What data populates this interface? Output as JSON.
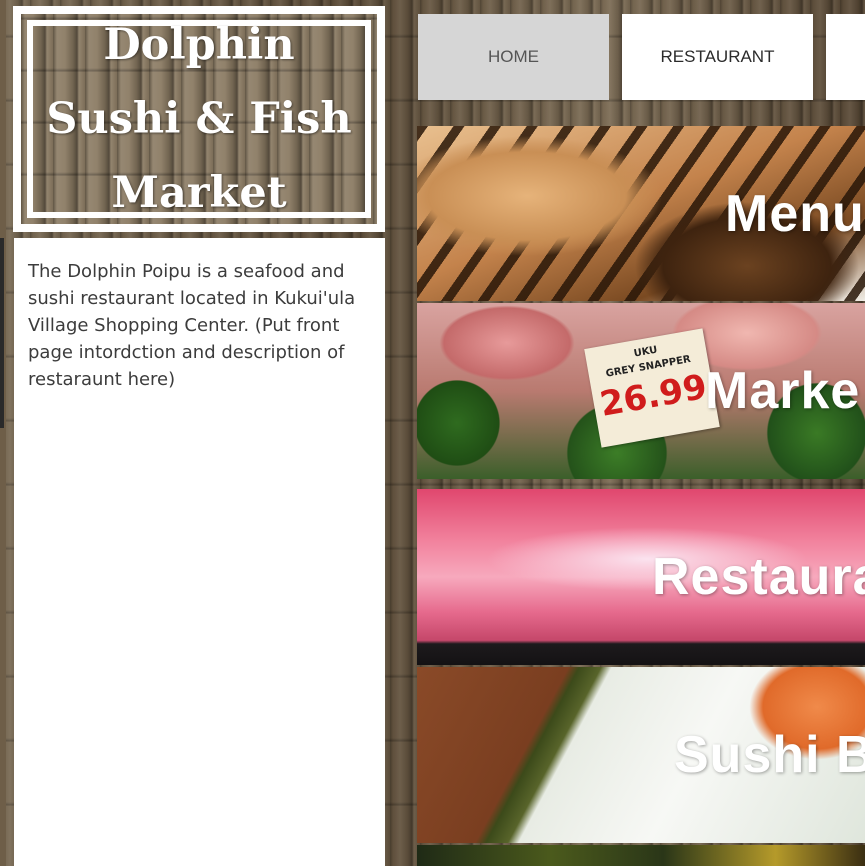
{
  "site": {
    "title": "Dolphin\nSushi & Fish\nMarket"
  },
  "intro": {
    "text": "The Dolphin Poipu is a seafood and sushi restaurant located in Kukui'ula Village Shopping Center. (Put front page intordction and description of restaraunt here)"
  },
  "nav": {
    "home_label": "HOME",
    "restaurant_label": "RESTAURANT",
    "active": "HOME"
  },
  "tiles": [
    {
      "label": "Menu"
    },
    {
      "label": "Marke"
    },
    {
      "label": "Restaura"
    },
    {
      "label": "Sushi B"
    }
  ],
  "market_tag": {
    "name": "UKU",
    "sub": "GREY SNAPPER",
    "price": "26.99"
  },
  "colors": {
    "nav_active_bg": "#d6d6d6",
    "nav_bg": "#ffffff",
    "panel_bg": "#ffffff",
    "title_text": "#ffffff",
    "price_red": "#d01c1c"
  }
}
